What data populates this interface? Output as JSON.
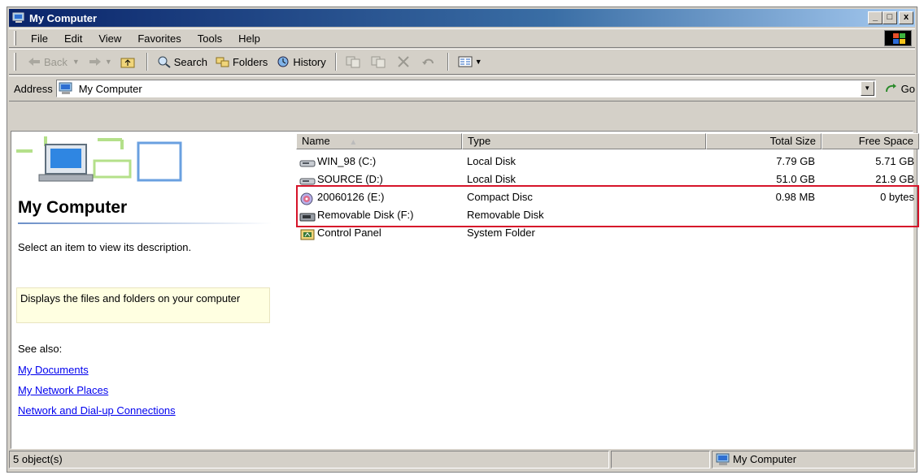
{
  "window": {
    "title": "My Computer",
    "controls": {
      "minimize": "_",
      "maximize": "□",
      "close": "x"
    }
  },
  "menu": [
    "File",
    "Edit",
    "View",
    "Favorites",
    "Tools",
    "Help"
  ],
  "toolbar": {
    "back": "Back",
    "search": "Search",
    "folders": "Folders",
    "history": "History"
  },
  "address": {
    "label": "Address",
    "value": "My Computer",
    "go": "Go"
  },
  "left_pane": {
    "title": "My Computer",
    "description": "Select an item to view its description.",
    "tip": "Displays the files and folders on your computer",
    "see_also": "See also:",
    "links": [
      "My Documents",
      "My Network Places",
      "Network and Dial-up Connections"
    ]
  },
  "list": {
    "columns": [
      "Name",
      "Type",
      "Total Size",
      "Free Space"
    ],
    "rows": [
      {
        "name": "WIN_98 (C:)",
        "type": "Local Disk",
        "total": "7.79 GB",
        "free": "5.71 GB",
        "icon": "hard-drive-icon"
      },
      {
        "name": "SOURCE (D:)",
        "type": "Local Disk",
        "total": "51.0 GB",
        "free": "21.9 GB",
        "icon": "hard-drive-icon"
      },
      {
        "name": "20060126 (E:)",
        "type": "Compact Disc",
        "total": "0.98 MB",
        "free": "0 bytes",
        "icon": "compact-disc-icon"
      },
      {
        "name": "Removable Disk (F:)",
        "type": "Removable Disk",
        "total": "",
        "free": "",
        "icon": "removable-disk-icon"
      },
      {
        "name": "Control Panel",
        "type": "System Folder",
        "total": "",
        "free": "",
        "icon": "control-panel-icon"
      }
    ]
  },
  "status": {
    "count": "5 object(s)",
    "zone": "My Computer"
  },
  "colors": {
    "highlight_box": "#d6142a",
    "titlebar": "#0a246a",
    "link": "#0000ee"
  }
}
